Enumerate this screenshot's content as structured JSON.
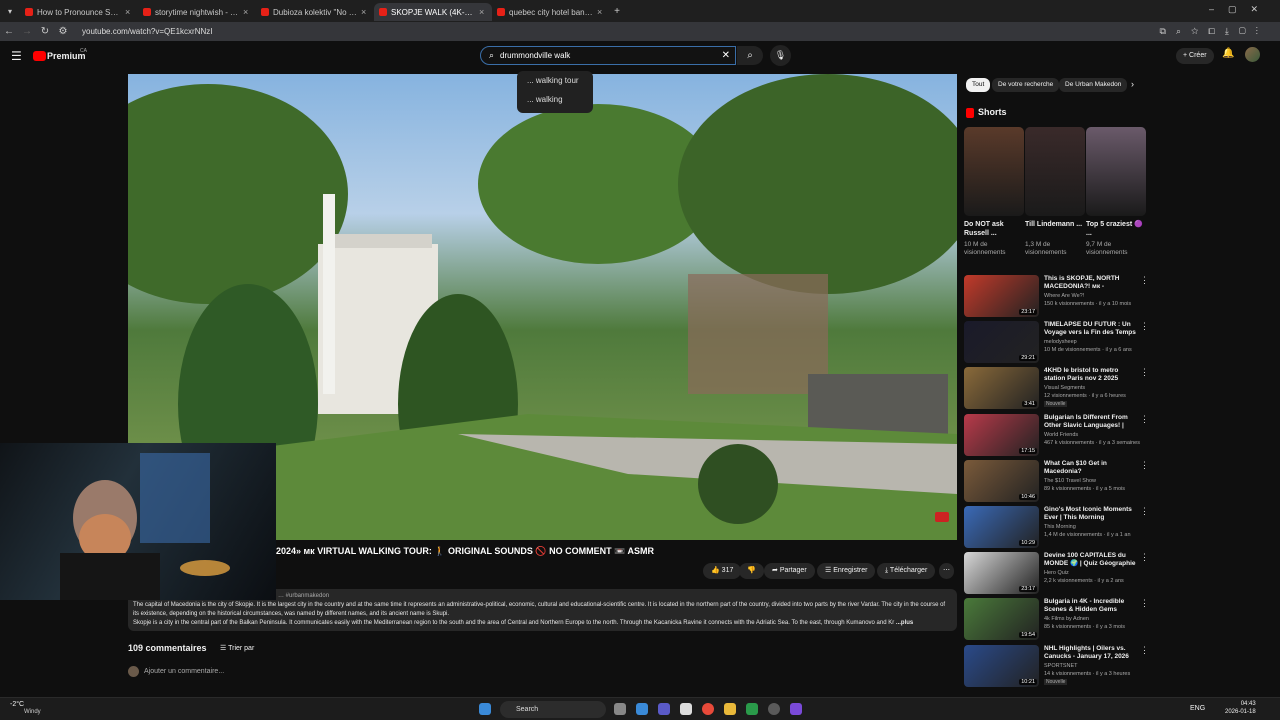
{
  "browser": {
    "tabs": [
      {
        "label": "How to Pronounce Skopje? (CO",
        "close": "×"
      },
      {
        "label": "storytime nightwish - YouTube",
        "close": "×"
      },
      {
        "label": "Dubioza kolektiv \"No Escape (f",
        "close": "×"
      },
      {
        "label": "SKOPJE WALK (4K-60)- Macedo",
        "close": "×",
        "active": true
      },
      {
        "label": "quebec city hotel bank of cana",
        "close": "×"
      }
    ],
    "new_tab": "+",
    "url": "youtube.com/watch?v=QE1kcxrNNzI"
  },
  "header": {
    "logo": "Premium",
    "logo_sup": "CA",
    "search_value": "drummondville walk",
    "create_label": "Créer",
    "suggestions": [
      "... walking tour",
      "... walking"
    ]
  },
  "video": {
    "title": "2024» мк VIRTUAL WALKING TOUR: 🚶 ORIGINAL SOUNDS 🚫 NO COMMENT 📼 ASMR",
    "likes": "317",
    "share": "Partager",
    "save": "Enregistrer",
    "download": "Télécharger",
    "hashtag": "… #urbanmakedon",
    "description_1": "The capital of Macedonia is the city of Skopje. It is the largest city in the country and at the same time it represents an administrative-political, economic, cultural and educational-scientific centre. It is located in the northern part of the country, divided into two parts by the river Vardar. The city in the course of its existence, depending on the historical circumstances, was named by different names, and its ancient name is Skupi.",
    "description_2": "Skopje is a city in the central part of the Balkan Peninsula. It communicates easily with the Mediterranean region to the south and the area of Central and Northern Europe to the north. Through the Kacanicka Ravine it connects with the Adriatic Sea. To the east, through Kumanovo and Kr",
    "more": "...plus",
    "comments_count": "109 commentaires",
    "sort": "Trier par",
    "add_comment": "Ajouter un commentaire..."
  },
  "sidebar": {
    "chips": [
      "Tout",
      "De votre recherche",
      "De Urban Makedon"
    ],
    "shorts_heading": "Shorts",
    "shorts": [
      {
        "title": "Do NOT ask Russell ...",
        "views": "10 M de visionnements",
        "color": "#5a3a2a"
      },
      {
        "title": "Till Lindemann ...",
        "views": "1,3 M de visionnements",
        "color": "#3a2a2a"
      },
      {
        "title": "Top 5 craziest 🟣 ...",
        "views": "9,7 M de visionnements",
        "color": "#6a5a6a"
      }
    ],
    "recommended": [
      {
        "title": "This is SKOPJE, NORTH MACEDONIA?! мк -",
        "channel": "Where Are We?!",
        "views": "150 k visionnements · il y a 10 mois",
        "duration": "23:17",
        "color": "#c23a2a",
        "badge": ""
      },
      {
        "title": "TIMELAPSE DU FUTUR : Un Voyage vers la Fin des Temps ...",
        "channel": "melodysheep",
        "views": "10 M de visionnements · il y a 6 ans",
        "duration": "29:21",
        "color": "#1a1a2a",
        "badge": ""
      },
      {
        "title": "4KHD le bristol to metro station Paris nov 2 2025",
        "channel": "Visual Segments",
        "views": "12 visionnements · il y a 6 heures",
        "duration": "3:41",
        "color": "#8a6a3a",
        "badge": "Nouvelle"
      },
      {
        "title": "Bulgarian Is Different From Other Slavic Languages! | Can ...",
        "channel": "World Friends",
        "views": "467 k visionnements · il y a 3 semaines",
        "duration": "17:15",
        "color": "#b83a4a",
        "badge": ""
      },
      {
        "title": "What Can $10 Get in Macedonia?",
        "channel": "The $10 Travel Show",
        "views": "89 k visionnements · il y a 5 mois",
        "duration": "10:46",
        "color": "#7a5a3a",
        "badge": ""
      },
      {
        "title": "Gino's Most Iconic Moments Ever | This Morning",
        "channel": "This Morning",
        "views": "1,4 M de visionnements · il y a 1 an",
        "duration": "10:29",
        "color": "#3a6ab8",
        "badge": ""
      },
      {
        "title": "Devine 100 CAPITALES du MONDE 🌍 | Quiz Géographie",
        "channel": "Hero Quiz",
        "views": "2,2 k visionnements · il y a 2 ans",
        "duration": "23:17",
        "color": "#d8d8d8",
        "badge": ""
      },
      {
        "title": "Bulgaria in 4K - Incredible Scenes & Hidden Gems",
        "channel": "4k Films by Adnen",
        "views": "85 k visionnements · il y a 3 mois",
        "duration": "19:54",
        "color": "#4a7a3a",
        "badge": ""
      },
      {
        "title": "NHL Highlights | Oilers vs. Canucks - January 17, 2026",
        "channel": "SPORTSNET",
        "views": "14 k visionnements · il y a 3 heures",
        "duration": "10:21",
        "color": "#2a4a8a",
        "badge": "Nouvelle"
      }
    ]
  },
  "taskbar": {
    "weather_temp": "-2°C",
    "weather_desc": "Windy",
    "search": "Search",
    "lang": "ENG",
    "time": "04:43",
    "date": "2026-01-18"
  },
  "colors": {
    "accent": "#ff0000",
    "bg": "#0f0f0f",
    "chip": "#272727"
  }
}
